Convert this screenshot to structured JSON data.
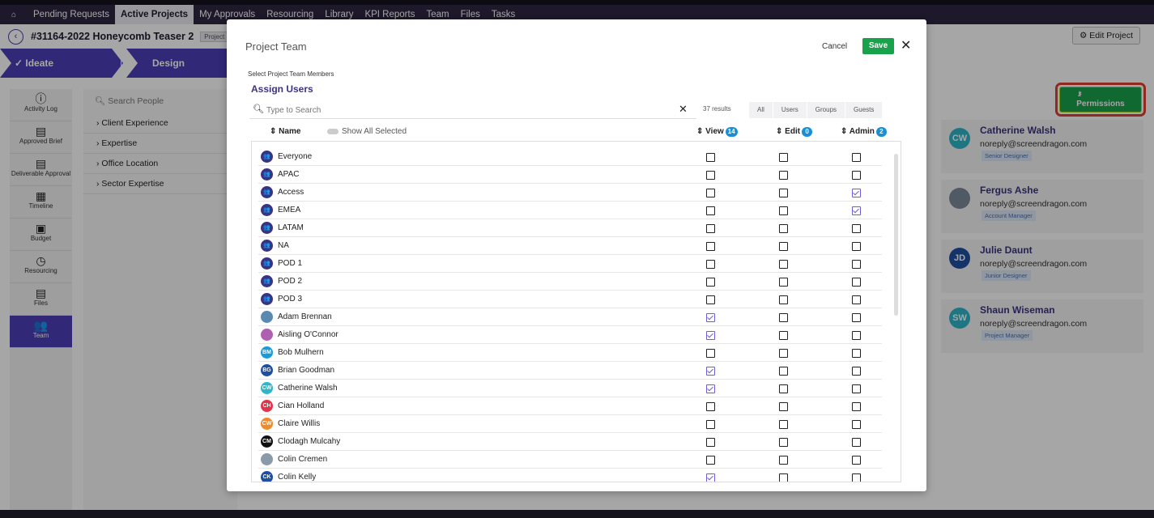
{
  "nav": {
    "home_icon": "home-icon",
    "items": [
      "Pending Requests",
      "Active Projects",
      "My Approvals",
      "Resourcing",
      "Library",
      "KPI Reports",
      "Team",
      "Files",
      "Tasks"
    ]
  },
  "project": {
    "title": "#31164-2022 Honeycomb Teaser 2",
    "badge": "Project",
    "edit_label": "Edit Project"
  },
  "stages": {
    "ideate": "Ideate",
    "design": "Design"
  },
  "sidebar": [
    {
      "label": "Activity Log",
      "icon": "info-icon"
    },
    {
      "label": "Approved Brief",
      "icon": "document-icon"
    },
    {
      "label": "Deliverable Approval",
      "icon": "document-icon"
    },
    {
      "label": "Timeline",
      "icon": "calendar-icon"
    },
    {
      "label": "Budget",
      "icon": "calculator-icon"
    },
    {
      "label": "Resourcing",
      "icon": "clock-icon"
    },
    {
      "label": "Files",
      "icon": "file-icon"
    },
    {
      "label": "Team",
      "icon": "team-icon"
    }
  ],
  "filters": {
    "search_placeholder": "Search People",
    "items": [
      "Client Experience",
      "Expertise",
      "Office Location",
      "Sector Expertise"
    ]
  },
  "permissions_label": "Permissions",
  "members": [
    {
      "initials": "CW",
      "name": "Catherine Walsh",
      "email": "noreply@screendragon.com",
      "role": "Senior Designer",
      "color": "#2fb6c9"
    },
    {
      "initials": "",
      "name": "Fergus Ashe",
      "email": "noreply@screendragon.com",
      "role": "Account Manager",
      "color": "#7b8a9c"
    },
    {
      "initials": "JD",
      "name": "Julie Daunt",
      "email": "noreply@screendragon.com",
      "role": "Junior Designer",
      "color": "#1f4fa0"
    },
    {
      "initials": "SW",
      "name": "Shaun Wiseman",
      "email": "noreply@screendragon.com",
      "role": "Project Manager",
      "color": "#2fb6c9"
    }
  ],
  "modal": {
    "title": "Project Team",
    "cancel": "Cancel",
    "save": "Save",
    "subtitle": "Select Project Team Members",
    "assign": "Assign Users",
    "search_placeholder": "Type to Search",
    "results": "37 results",
    "filters": [
      "All",
      "Users",
      "Groups",
      "Guests"
    ],
    "col_name": "Name",
    "show_all": "Show All Selected",
    "col_view": "View",
    "view_count": "14",
    "col_edit": "Edit",
    "edit_count": "0",
    "col_admin": "Admin",
    "admin_count": "2"
  },
  "rows": [
    {
      "name": "Everyone",
      "initials": "",
      "group": true,
      "color": "#3a3480",
      "view": false,
      "edit": false,
      "admin": false
    },
    {
      "name": "APAC",
      "initials": "",
      "group": true,
      "color": "#3a3480",
      "view": false,
      "edit": false,
      "admin": false
    },
    {
      "name": "Access",
      "initials": "",
      "group": true,
      "color": "#3a3480",
      "view": false,
      "edit": false,
      "admin": true
    },
    {
      "name": "EMEA",
      "initials": "",
      "group": true,
      "color": "#3a3480",
      "view": false,
      "edit": false,
      "admin": true
    },
    {
      "name": "LATAM",
      "initials": "",
      "group": true,
      "color": "#3a3480",
      "view": false,
      "edit": false,
      "admin": false
    },
    {
      "name": "NA",
      "initials": "",
      "group": true,
      "color": "#3a3480",
      "view": false,
      "edit": false,
      "admin": false
    },
    {
      "name": "POD 1",
      "initials": "",
      "group": true,
      "color": "#3a3480",
      "view": false,
      "edit": false,
      "admin": false
    },
    {
      "name": "POD 2",
      "initials": "",
      "group": true,
      "color": "#3a3480",
      "view": false,
      "edit": false,
      "admin": false
    },
    {
      "name": "POD 3",
      "initials": "",
      "group": true,
      "color": "#3a3480",
      "view": false,
      "edit": false,
      "admin": false
    },
    {
      "name": "Adam Brennan",
      "initials": "",
      "group": false,
      "color": "#5a8ab0",
      "view": true,
      "edit": false,
      "admin": false
    },
    {
      "name": "Aisling O'Connor",
      "initials": "",
      "group": false,
      "color": "#b060b0",
      "view": true,
      "edit": false,
      "admin": false
    },
    {
      "name": "Bob Mulhern",
      "initials": "BM",
      "group": false,
      "color": "#1a9ad8",
      "view": false,
      "edit": false,
      "admin": false
    },
    {
      "name": "Brian Goodman",
      "initials": "BG",
      "group": false,
      "color": "#1f4fa0",
      "view": true,
      "edit": false,
      "admin": false
    },
    {
      "name": "Catherine Walsh",
      "initials": "CW",
      "group": false,
      "color": "#2fb6c9",
      "view": true,
      "edit": false,
      "admin": false
    },
    {
      "name": "Cian Holland",
      "initials": "CH",
      "group": false,
      "color": "#e0344a",
      "view": false,
      "edit": false,
      "admin": false
    },
    {
      "name": "Claire Willis",
      "initials": "CW",
      "group": false,
      "color": "#f08a2a",
      "view": false,
      "edit": false,
      "admin": false
    },
    {
      "name": "Clodagh Mulcahy",
      "initials": "CM",
      "group": false,
      "color": "#111111",
      "view": false,
      "edit": false,
      "admin": false
    },
    {
      "name": "Colin Cremen",
      "initials": "",
      "group": false,
      "color": "#8a9aa8",
      "view": false,
      "edit": false,
      "admin": false
    },
    {
      "name": "Colin Kelly",
      "initials": "CK",
      "group": false,
      "color": "#1f4fa0",
      "view": true,
      "edit": false,
      "admin": false
    }
  ]
}
